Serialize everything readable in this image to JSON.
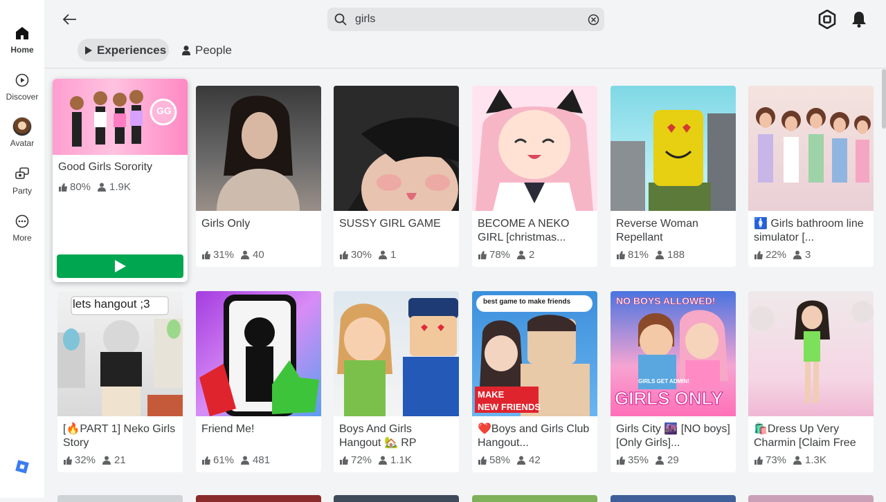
{
  "nav": {
    "items": [
      {
        "label": "Home",
        "icon": "home-icon"
      },
      {
        "label": "Discover",
        "icon": "discover-icon"
      },
      {
        "label": "Avatar",
        "icon": "avatar-icon"
      },
      {
        "label": "Party",
        "icon": "party-icon"
      },
      {
        "label": "More",
        "icon": "more-icon"
      }
    ]
  },
  "search": {
    "value": "girls"
  },
  "tabs": {
    "experiences": "Experiences",
    "people": "People"
  },
  "thumb_text": {
    "gg": "GG",
    "hangout": "lets hangout ;3",
    "friends": "best game to make friends",
    "make": "MAKE",
    "new_friends": "NEW FRIENDS",
    "no_boys": "NO BOYS ALLOWED!",
    "admin": "GIRLS GET ADMIN!",
    "girls_only": "GIRLS ONLY"
  },
  "cards": [
    {
      "title": "Good Girls Sorority",
      "rating": "80%",
      "players": "1.9K"
    },
    {
      "title": "Girls Only",
      "rating": "31%",
      "players": "40"
    },
    {
      "title": "SUSSY  GIRL GAME",
      "rating": "30%",
      "players": "1"
    },
    {
      "title": "BECOME A NEKO GIRL [christmas...",
      "rating": "78%",
      "players": "2"
    },
    {
      "title": "Reverse Woman Repellant",
      "rating": "81%",
      "players": "188"
    },
    {
      "title": "🚺 Girls bathroom line simulator [...",
      "rating": "22%",
      "players": "3"
    },
    {
      "title": "[🔥PART 1] Neko Girls Story",
      "rating": "32%",
      "players": "21"
    },
    {
      "title": "Friend Me!",
      "rating": "61%",
      "players": "481"
    },
    {
      "title": "Boys And Girls Hangout 🏡 RP",
      "rating": "72%",
      "players": "1.1K"
    },
    {
      "title": "❤️Boys and Girls Club Hangout...",
      "rating": "58%",
      "players": "42"
    },
    {
      "title": "Girls City 🌆 [NO boys] [Only Girls]...",
      "rating": "35%",
      "players": "29"
    },
    {
      "title": "🛍️Dress Up Very Charmin [Claim Free",
      "rating": "73%",
      "players": "1.3K"
    }
  ],
  "colors": {
    "play": "#00a650",
    "accent_pink": "#ff7eb6"
  }
}
